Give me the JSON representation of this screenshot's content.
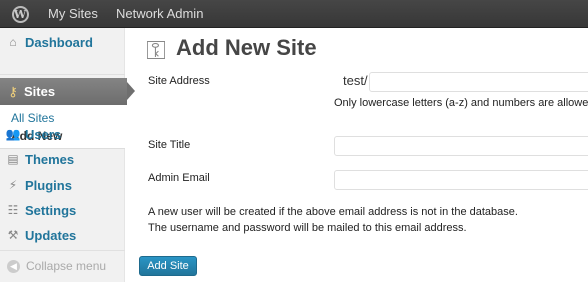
{
  "adminbar": {
    "my_sites": "My Sites",
    "network_admin": "Network Admin"
  },
  "sidebar": {
    "dashboard": "Dashboard",
    "sites": "Sites",
    "submenu": {
      "all_sites": "All Sites",
      "add_new": "Add New"
    },
    "users": "Users",
    "themes": "Themes",
    "plugins": "Plugins",
    "settings": "Settings",
    "updates": "Updates",
    "collapse": "Collapse menu"
  },
  "main": {
    "title": "Add New Site",
    "site_address_label": "Site Address",
    "site_address_prefix": "test/",
    "site_address_value": "",
    "site_address_hint": "Only lowercase letters (a-z) and numbers are allowed.",
    "site_title_label": "Site Title",
    "site_title_value": "",
    "admin_email_label": "Admin Email",
    "admin_email_value": "",
    "note_line1": "A new user will be created if the above email address is not in the database.",
    "note_line2": "The username and password will be mailed to this email address.",
    "submit_label": "Add Site"
  },
  "colors": {
    "link": "#21759b",
    "button": "#21759b",
    "adminbar": "#464646"
  }
}
